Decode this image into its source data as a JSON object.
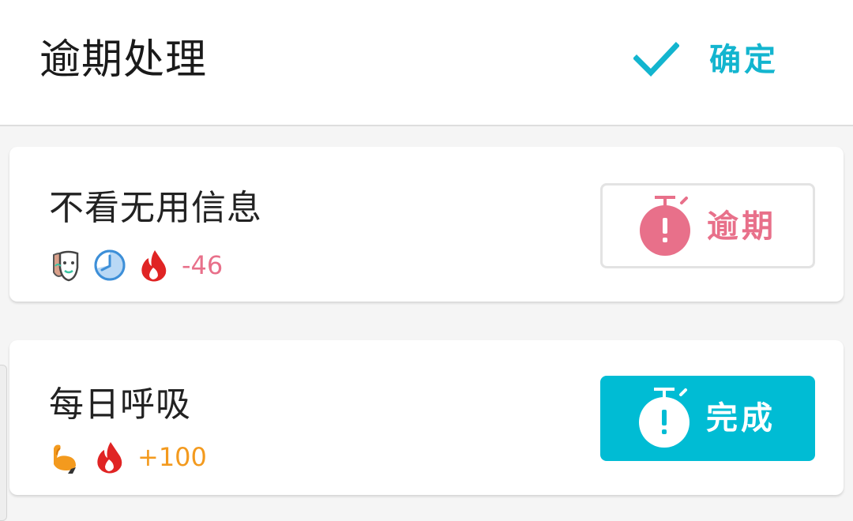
{
  "header": {
    "title": "逾期处理",
    "confirm_label": "确定",
    "confirm_icon": "check-icon"
  },
  "colors": {
    "accent": "#00bcd4",
    "overdue": "#e8708a",
    "positive": "#f39a1e"
  },
  "tasks": [
    {
      "title": "不看无用信息",
      "icons": [
        "mask-icon",
        "clock-icon",
        "flame-icon"
      ],
      "score": "-46",
      "score_color": "#e8708a",
      "action": {
        "label": "逾期",
        "icon": "stopwatch-alert-icon",
        "state": "overdue"
      }
    },
    {
      "title": "每日呼吸",
      "icons": [
        "flexed-arm-icon",
        "flame-icon"
      ],
      "score": "+100",
      "score_color": "#f39a1e",
      "action": {
        "label": "完成",
        "icon": "stopwatch-alert-icon",
        "state": "done"
      }
    }
  ]
}
